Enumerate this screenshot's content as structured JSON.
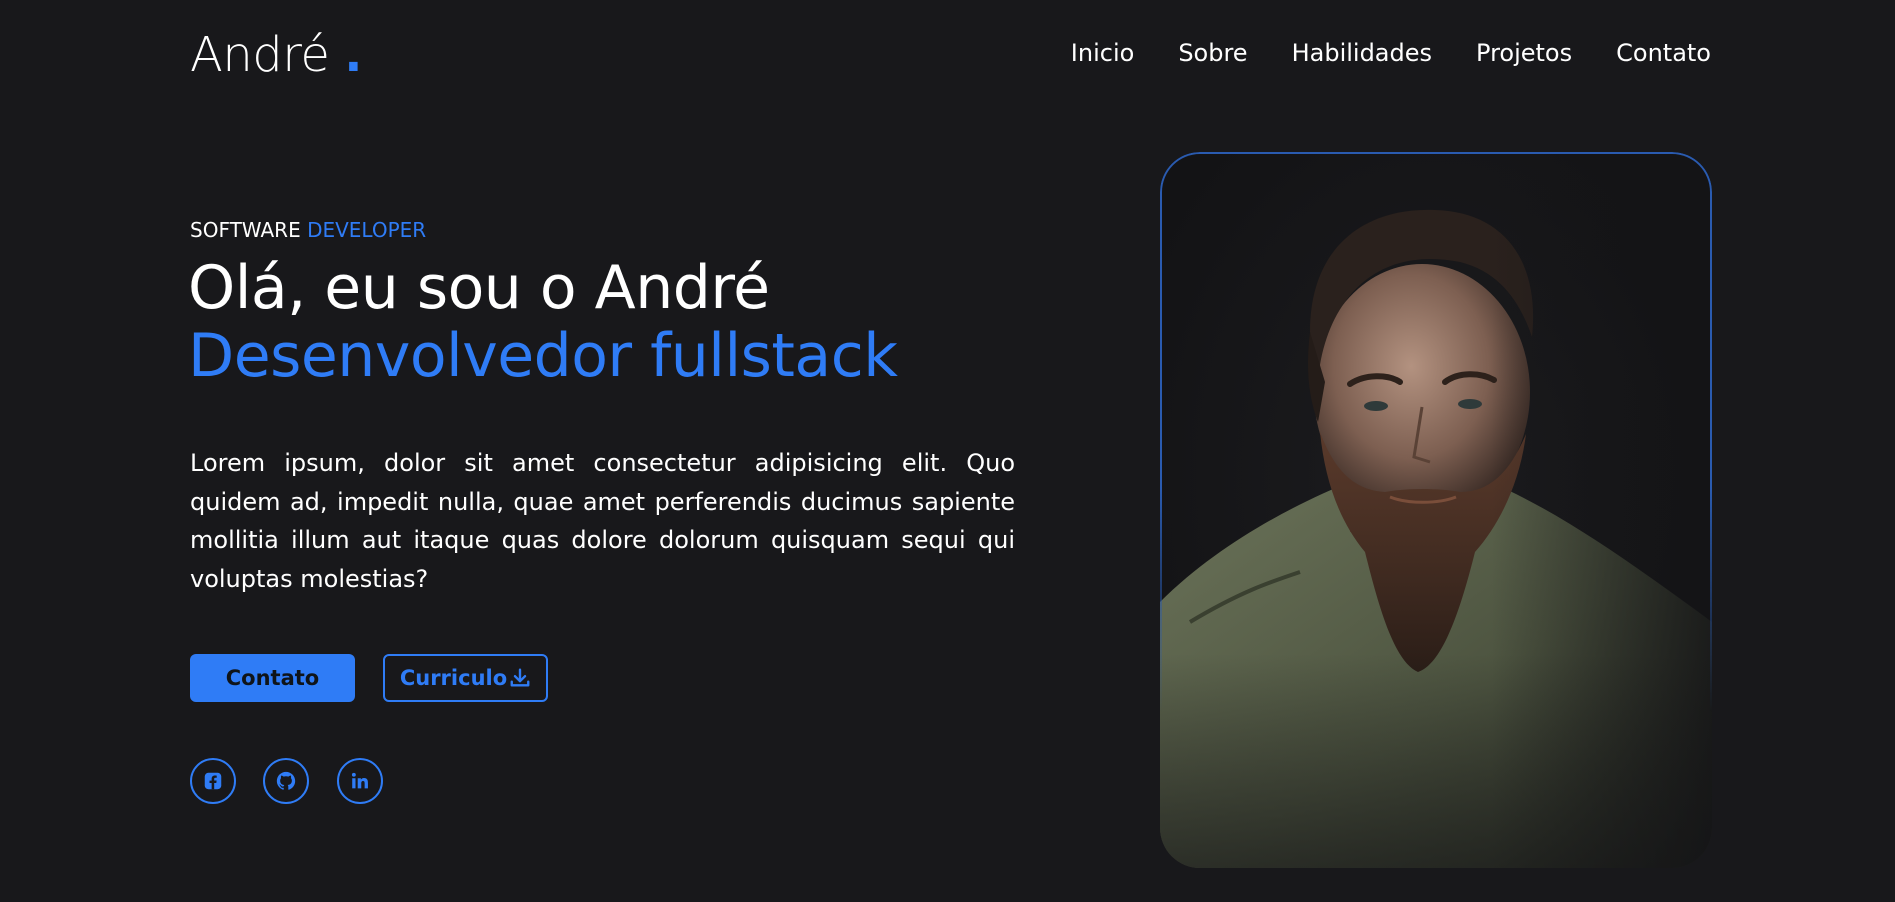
{
  "header": {
    "logo_text": "André",
    "logo_dot": ".",
    "nav": [
      {
        "label": "Inicio"
      },
      {
        "label": "Sobre"
      },
      {
        "label": "Habilidades"
      },
      {
        "label": "Projetos"
      },
      {
        "label": "Contato"
      }
    ]
  },
  "hero": {
    "eyebrow_primary": "SOFTWARE",
    "eyebrow_accent": "DEVELOPER",
    "headline_line1": "Olá, eu sou o André",
    "headline_line2": "Desenvolvedor fullstack",
    "bio": "Lorem ipsum, dolor sit amet consectetur adipisicing elit. Quo quidem ad, impedit nulla, quae amet perferendis ducimus sapiente mollitia illum aut itaque quas dolore dolorum quisquam sequi qui voluptas molestias?",
    "buttons": {
      "contact_label": "Contato",
      "cv_label": "Curriculo"
    },
    "socials": [
      {
        "icon": "facebook-icon"
      },
      {
        "icon": "github-icon"
      },
      {
        "icon": "linkedin-icon"
      }
    ]
  },
  "colors": {
    "background": "#18181b",
    "accent": "#2f7cf6",
    "text": "#ffffff"
  }
}
